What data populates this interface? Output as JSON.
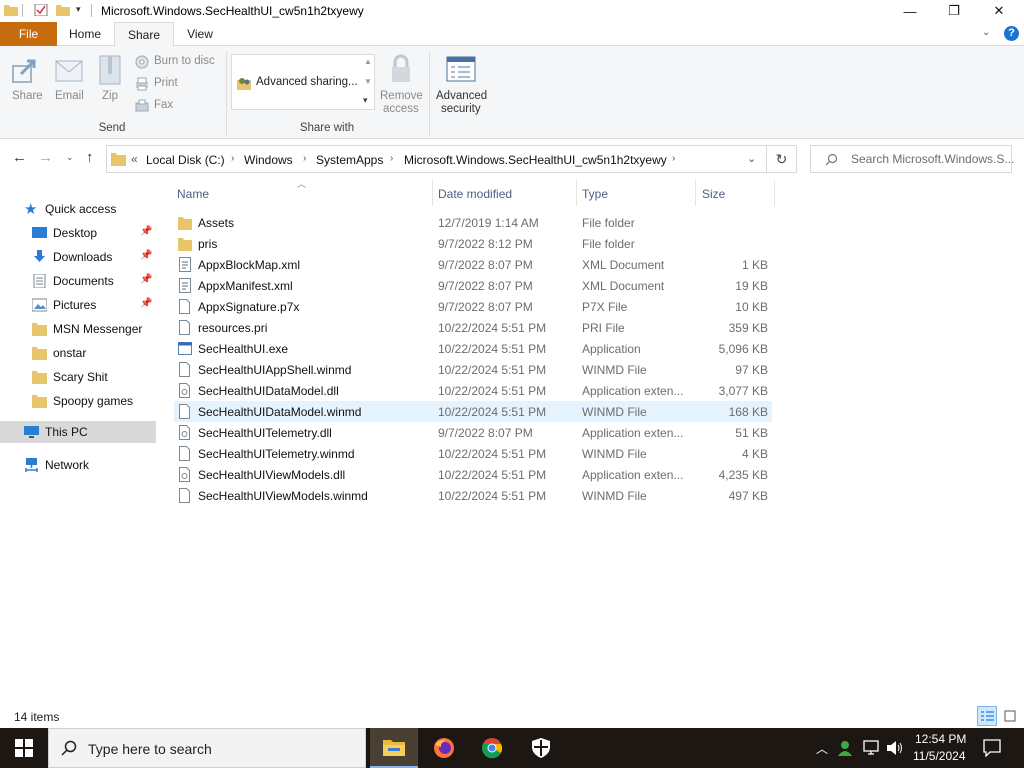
{
  "window": {
    "title": "Microsoft.Windows.SecHealthUI_cw5n1h2txyewy",
    "min_label": "—",
    "max_label": "❐",
    "close_label": "✕"
  },
  "tabs": {
    "file": "File",
    "home": "Home",
    "share": "Share",
    "view": "View"
  },
  "ribbon": {
    "share_btn": "Share",
    "email_btn": "Email",
    "zip_btn": "Zip",
    "burn_btn": "Burn to disc",
    "print_btn": "Print",
    "fax_btn": "Fax",
    "send_group": "Send",
    "adv_sharing": "Advanced sharing...",
    "remove_access_1": "Remove",
    "remove_access_2": "access",
    "adv_security_1": "Advanced",
    "adv_security_2": "security",
    "share_with_group": "Share with"
  },
  "address": {
    "prefix": "«",
    "crumbs": [
      "Local Disk (C:)",
      "Windows",
      "SystemApps",
      "Microsoft.Windows.SecHealthUI_cw5n1h2txyewy"
    ],
    "search_placeholder": "Search Microsoft.Windows.S..."
  },
  "nav": {
    "quick_access": "Quick access",
    "items": [
      "Desktop",
      "Downloads",
      "Documents",
      "Pictures",
      "MSN Messenger",
      "onstar",
      "Scary Shit",
      "Spoopy games"
    ],
    "this_pc": "This PC",
    "network": "Network"
  },
  "columns": {
    "name": "Name",
    "date": "Date modified",
    "type": "Type",
    "size": "Size"
  },
  "files": [
    {
      "name": "Assets",
      "date": "12/7/2019 1:14 AM",
      "type": "File folder",
      "size": "",
      "icon": "folder-icon"
    },
    {
      "name": "pris",
      "date": "9/7/2022 8:12 PM",
      "type": "File folder",
      "size": "",
      "icon": "folder-icon"
    },
    {
      "name": "AppxBlockMap.xml",
      "date": "9/7/2022 8:07 PM",
      "type": "XML Document",
      "size": "1 KB",
      "icon": "xml-icon"
    },
    {
      "name": "AppxManifest.xml",
      "date": "9/7/2022 8:07 PM",
      "type": "XML Document",
      "size": "19 KB",
      "icon": "xml-icon"
    },
    {
      "name": "AppxSignature.p7x",
      "date": "9/7/2022 8:07 PM",
      "type": "P7X File",
      "size": "10 KB",
      "icon": "file-icon"
    },
    {
      "name": "resources.pri",
      "date": "10/22/2024 5:51 PM",
      "type": "PRI File",
      "size": "359 KB",
      "icon": "file-icon"
    },
    {
      "name": "SecHealthUI.exe",
      "date": "10/22/2024 5:51 PM",
      "type": "Application",
      "size": "5,096 KB",
      "icon": "exe-icon"
    },
    {
      "name": "SecHealthUIAppShell.winmd",
      "date": "10/22/2024 5:51 PM",
      "type": "WINMD File",
      "size": "97 KB",
      "icon": "file-icon"
    },
    {
      "name": "SecHealthUIDataModel.dll",
      "date": "10/22/2024 5:51 PM",
      "type": "Application exten...",
      "size": "3,077 KB",
      "icon": "dll-icon"
    },
    {
      "name": "SecHealthUIDataModel.winmd",
      "date": "10/22/2024 5:51 PM",
      "type": "WINMD File",
      "size": "168 KB",
      "icon": "file-icon"
    },
    {
      "name": "SecHealthUITelemetry.dll",
      "date": "9/7/2022 8:07 PM",
      "type": "Application exten...",
      "size": "51 KB",
      "icon": "dll-icon"
    },
    {
      "name": "SecHealthUITelemetry.winmd",
      "date": "10/22/2024 5:51 PM",
      "type": "WINMD File",
      "size": "4 KB",
      "icon": "file-icon"
    },
    {
      "name": "SecHealthUIViewModels.dll",
      "date": "10/22/2024 5:51 PM",
      "type": "Application exten...",
      "size": "4,235 KB",
      "icon": "dll-icon"
    },
    {
      "name": "SecHealthUIViewModels.winmd",
      "date": "10/22/2024 5:51 PM",
      "type": "WINMD File",
      "size": "497 KB",
      "icon": "file-icon"
    }
  ],
  "selected_index": 9,
  "status": {
    "item_count": "14 items"
  },
  "taskbar": {
    "search_placeholder": "Type here to search",
    "time": "12:54 PM",
    "date": "11/5/2024"
  },
  "colors": {
    "accent_file_tab": "#c76c0e",
    "folder": "#e8c56a",
    "selection": "#e5f3ff",
    "taskbar": "#1c1712"
  }
}
